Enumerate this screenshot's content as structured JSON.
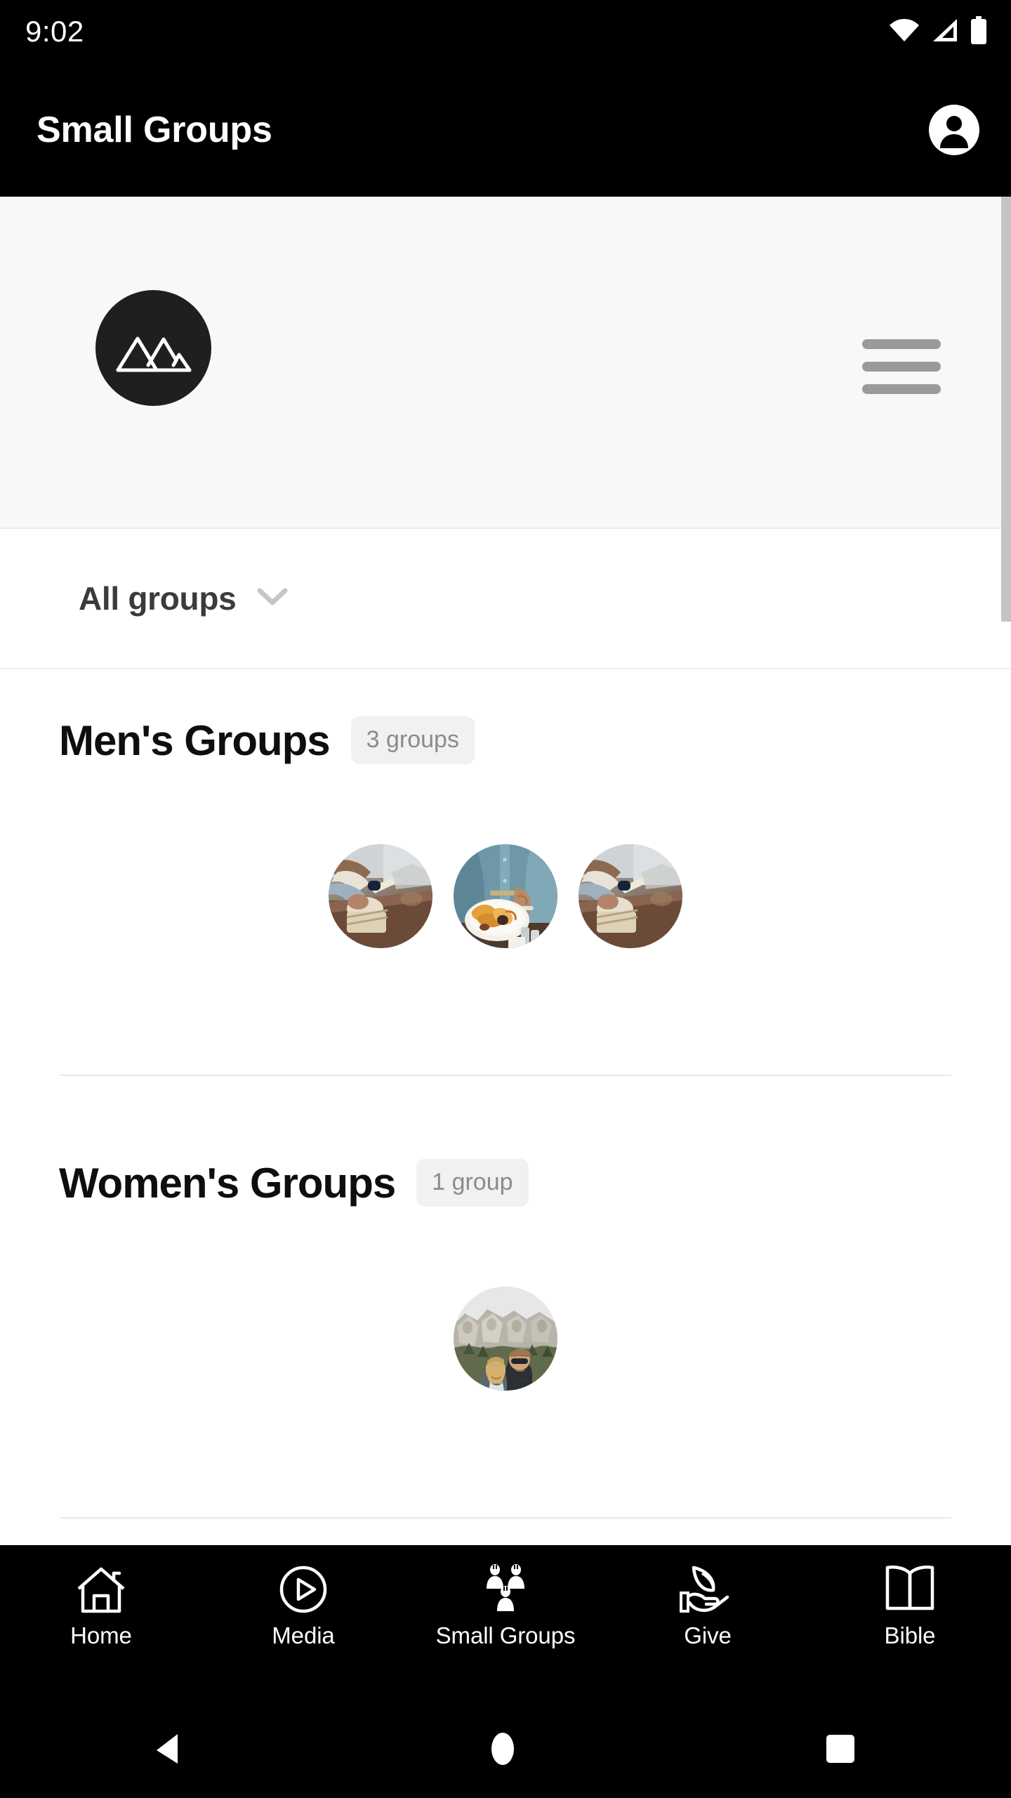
{
  "status_bar": {
    "time": "9:02",
    "icons": [
      "wifi-icon",
      "cellular-signal-icon",
      "battery-icon"
    ]
  },
  "app_bar": {
    "title": "Small Groups",
    "account_icon": "account-circle-icon"
  },
  "logo_banner": {
    "logo_icon": "mountain-logo-icon",
    "menu_icon": "hamburger-menu-icon",
    "background_color": "#f8f8f8",
    "logo_background_color": "#1f1f21"
  },
  "filter": {
    "label": "All groups",
    "chevron_icon": "chevron-down-icon"
  },
  "sections": [
    {
      "title": "Men's Groups",
      "count_label": "3 groups",
      "groups": [
        {
          "thumbnail": "men-writing-notebook-photo"
        },
        {
          "thumbnail": "man-denim-shirt-meal-photo"
        },
        {
          "thumbnail": "men-writing-notebook-photo"
        }
      ]
    },
    {
      "title": "Women's Groups",
      "count_label": "1 group",
      "groups": [
        {
          "thumbnail": "couple-mount-rushmore-photo"
        }
      ]
    }
  ],
  "bottom_nav": {
    "items": [
      {
        "label": "Home",
        "icon": "home-icon",
        "active": false
      },
      {
        "label": "Media",
        "icon": "play-circle-icon",
        "active": false
      },
      {
        "label": "Small Groups",
        "icon": "people-group-icon",
        "active": true
      },
      {
        "label": "Give",
        "icon": "hand-leaf-icon",
        "active": false
      },
      {
        "label": "Bible",
        "icon": "open-book-icon",
        "active": false
      }
    ]
  },
  "android_nav": {
    "back": "back-triangle-icon",
    "home": "home-circle-icon",
    "recents": "recents-square-icon"
  },
  "scrollbar": {
    "visible": true,
    "color": "#c4c4c4"
  }
}
